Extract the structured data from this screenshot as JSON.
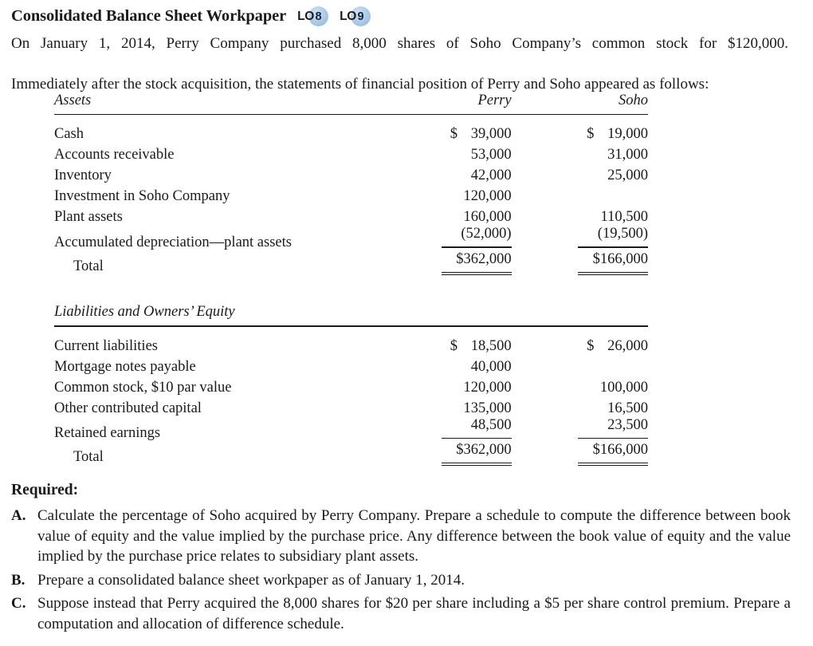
{
  "title": {
    "heading": "Consolidated Balance Sheet Workpaper",
    "badges": [
      {
        "label": "LO",
        "number": "8"
      },
      {
        "label": "LO",
        "number": "9"
      }
    ],
    "badge_color": "#a9c9e7"
  },
  "intro": {
    "line1": "On January 1, 2014, Perry Company purchased 8,000 shares of Soho Company’s common stock for $120,000.",
    "line2": "Immediately after the stock acquisition, the statements of financial position of Perry and Soho appeared as follows:"
  },
  "table": {
    "columns": {
      "label": "",
      "perry": "Perry",
      "soho": "Soho"
    },
    "assets": {
      "section_title": "Assets",
      "rows": [
        {
          "label": "Cash",
          "perry": "39,000",
          "soho": "19,000",
          "perry_symbol": "$",
          "soho_symbol": "$"
        },
        {
          "label": "Accounts receivable",
          "perry": "53,000",
          "soho": "31,000",
          "perry_symbol": "",
          "soho_symbol": ""
        },
        {
          "label": "Inventory",
          "perry": "42,000",
          "soho": "25,000",
          "perry_symbol": "",
          "soho_symbol": ""
        },
        {
          "label": "Investment in Soho Company",
          "perry": "120,000",
          "soho": "",
          "perry_symbol": "",
          "soho_symbol": ""
        },
        {
          "label": "Plant assets",
          "perry": "160,000",
          "soho": "110,500",
          "perry_symbol": "",
          "soho_symbol": ""
        },
        {
          "label": "Accumulated depreciation—plant assets",
          "perry": "(52,000)",
          "soho": "(19,500)",
          "perry_symbol": "",
          "soho_symbol": ""
        }
      ],
      "total": {
        "label": "Total",
        "perry": "$362,000",
        "soho": "$166,000"
      }
    },
    "equity": {
      "section_title": "Liabilities and Owners’ Equity",
      "rows": [
        {
          "label": "Current liabilities",
          "perry": "18,500",
          "soho": "26,000",
          "perry_symbol": "$",
          "soho_symbol": "$"
        },
        {
          "label": "Mortgage notes payable",
          "perry": "40,000",
          "soho": "",
          "perry_symbol": "",
          "soho_symbol": ""
        },
        {
          "label": "Common stock, $10 par value",
          "perry": "120,000",
          "soho": "100,000",
          "perry_symbol": "",
          "soho_symbol": ""
        },
        {
          "label": "Other contributed capital",
          "perry": "135,000",
          "soho": "16,500",
          "perry_symbol": "",
          "soho_symbol": ""
        },
        {
          "label": "Retained earnings",
          "perry": "48,500",
          "soho": "23,500",
          "perry_symbol": "",
          "soho_symbol": ""
        }
      ],
      "total": {
        "label": "Total",
        "perry": "$362,000",
        "soho": "$166,000"
      }
    }
  },
  "required": {
    "heading": "Required:",
    "items": [
      {
        "letter": "A.",
        "text": "Calculate the percentage of Soho acquired by Perry Company. Prepare a schedule to compute the difference between book value of equity and the value implied by the purchase price. Any difference between the book value of equity and the value implied by the purchase price relates to subsidiary plant assets."
      },
      {
        "letter": "B.",
        "text": "Prepare a consolidated balance sheet workpaper as of January 1, 2014."
      },
      {
        "letter": "C.",
        "text": "Suppose instead that Perry acquired the 8,000 shares for $20 per share including a $5 per share control premium. Prepare a computation and allocation of difference schedule."
      }
    ]
  }
}
